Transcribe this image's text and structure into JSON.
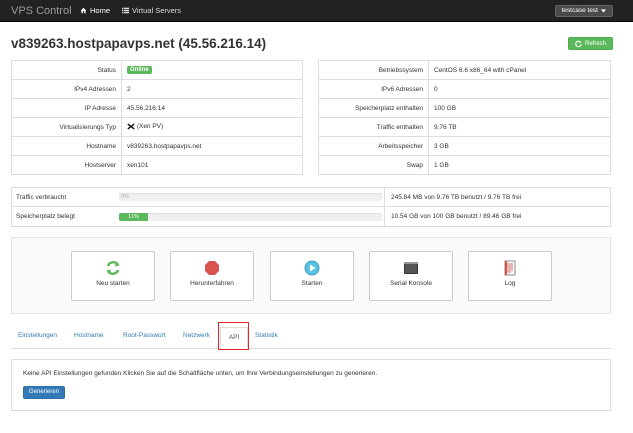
{
  "navbar": {
    "brand": "VPS Control",
    "home_label": "Home",
    "virtual_servers_label": "Virtual Servers",
    "user_label": "testcase test"
  },
  "header": {
    "title": "v839263.hostpapavps.net (45.56.216.14)",
    "refresh_label": "Refresh"
  },
  "info_left": {
    "status_key": "Status",
    "status_value": "Online",
    "ipv4_key": "IPv4 Adressen",
    "ipv4_value": "2",
    "ip_key": "IP Adresse",
    "ip_value": "45.56.216.14",
    "virt_key": "Virtualisierungs Typ",
    "virt_value": "(Xen PV)",
    "hostname_key": "Hostname",
    "hostname_value": "v839263.hostpapavps.net",
    "hostserver_key": "Hostserver",
    "hostserver_value": "xen101"
  },
  "info_right": {
    "os_key": "Betriebssystem",
    "os_value": "CentOS 6.6 x86_64 with cPanel",
    "ipv6_key": "IPv6 Adressen",
    "ipv6_value": "0",
    "storage_key": "Speicherplatz enthalten",
    "storage_value": "100 GB",
    "traffic_key": "Traffic enthalten",
    "traffic_value": "9.76 TB",
    "ram_key": "Arbeitsspeicher",
    "ram_value": "3 GB",
    "swap_key": "Swap",
    "swap_value": "1 GB"
  },
  "usage": {
    "traffic_label": "Traffic verbraucht",
    "traffic_percent": 0,
    "traffic_bar_text": "0%",
    "traffic_text": "245.84 MB von 9.76 TB benutzt / 9.76 TB frei",
    "storage_label": "Speicherplatz belegt",
    "storage_percent": 11,
    "storage_bar_text": "11%",
    "storage_text": "10.54 GB von 100 GB benutzt / 89.46 GB frei"
  },
  "actions": {
    "restart": "Neu starten",
    "shutdown": "Herunterfahren",
    "start": "Starten",
    "serial_console": "Serial Konsole",
    "log": "Log"
  },
  "tabs": {
    "settings": "Einstellungen",
    "hostname": "Hostname",
    "root_password": "Root-Passwort",
    "network": "Netzwerk",
    "api": "API",
    "statistics": "Statistik"
  },
  "api_panel": {
    "message": "Keine API Einstellungen gefunden Klicken Sie auf die Schaltfläche unten, um Ihre Verbindungseinstellungen zu generieren.",
    "generate_label": "Generieren"
  },
  "colors": {
    "navbar": "#222222",
    "success": "#5cb85c",
    "primary": "#337ab7",
    "link": "#337ab7",
    "highlight": "#e0262b"
  }
}
